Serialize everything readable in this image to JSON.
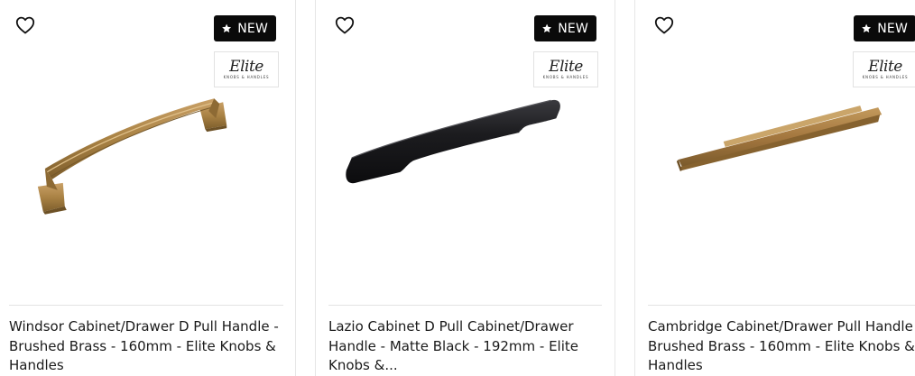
{
  "products": [
    {
      "badge": "NEW",
      "brand": {
        "name": "Elite",
        "sub": "KNOBS & HANDLES"
      },
      "title": "Windsor Cabinet/Drawer D Pull Handle - Brushed Brass - 160mm - Elite Knobs & Handles",
      "finish_color": "#a98244"
    },
    {
      "badge": "NEW",
      "brand": {
        "name": "Elite",
        "sub": "KNOBS & HANDLES"
      },
      "title": "Lazio Cabinet D Pull Cabinet/Drawer Handle - Matte Black - 192mm - Elite Knobs &...",
      "finish_color": "#1c1c1f"
    },
    {
      "badge": "NEW",
      "brand": {
        "name": "Elite",
        "sub": "KNOBS & HANDLES"
      },
      "title": "Cambridge Cabinet/Drawer Pull Handle - Brushed Brass - 160mm - Elite Knobs & Handles",
      "finish_color": "#a4773f"
    }
  ]
}
